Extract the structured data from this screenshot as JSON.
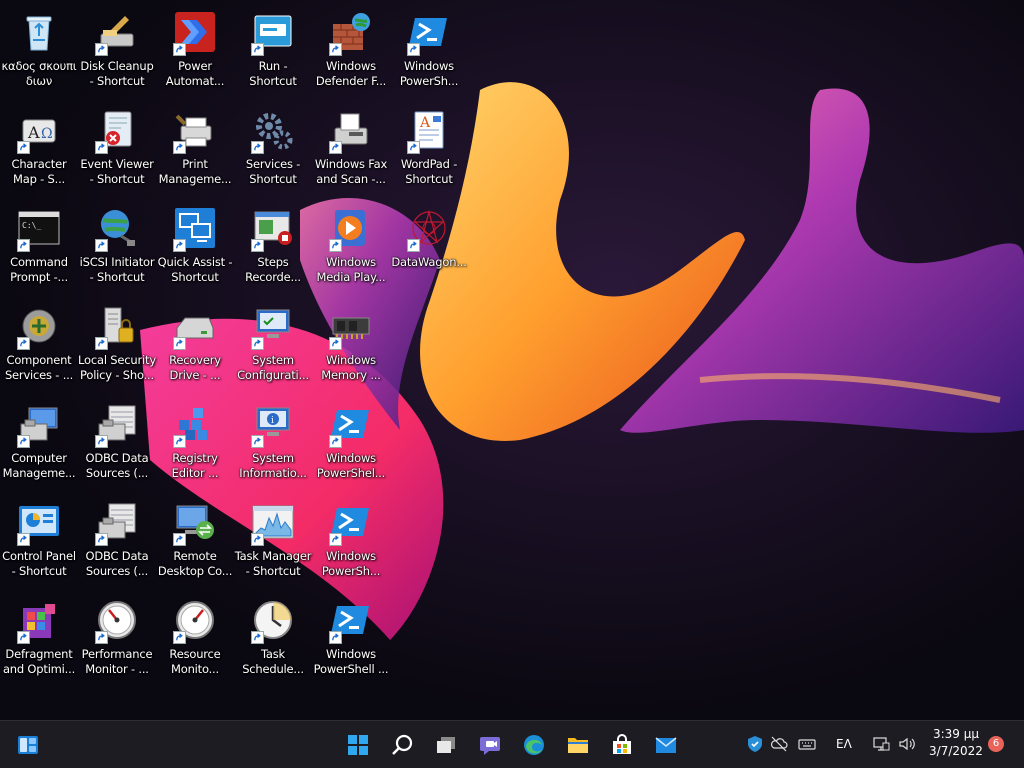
{
  "desktop_icons": [
    {
      "label": "καδος σκουπι\nδιων",
      "icon": "recycle-bin-icon",
      "shortcut": false
    },
    {
      "label": "Disk Cleanup\n- Shortcut",
      "icon": "disk-cleanup-icon",
      "shortcut": true
    },
    {
      "label": "Power\nAutomat...",
      "icon": "power-automate-icon",
      "shortcut": true
    },
    {
      "label": "Run -\nShortcut",
      "icon": "run-icon",
      "shortcut": true
    },
    {
      "label": "Windows\nDefender F...",
      "icon": "firewall-icon",
      "shortcut": true
    },
    {
      "label": "Windows\nPowerSh...",
      "icon": "powershell-icon",
      "shortcut": true
    },
    {
      "label": "Character\nMap - S...",
      "icon": "character-map-icon",
      "shortcut": true
    },
    {
      "label": "Event Viewer\n- Shortcut",
      "icon": "event-viewer-icon",
      "shortcut": true
    },
    {
      "label": "Print\nManageme...",
      "icon": "print-management-icon",
      "shortcut": true
    },
    {
      "label": "Services -\nShortcut",
      "icon": "services-icon",
      "shortcut": true
    },
    {
      "label": "Windows Fax\nand Scan -...",
      "icon": "fax-icon",
      "shortcut": true
    },
    {
      "label": "WordPad -\nShortcut",
      "icon": "wordpad-icon",
      "shortcut": true
    },
    {
      "label": "Command\nPrompt -...",
      "icon": "command-prompt-icon",
      "shortcut": true
    },
    {
      "label": "iSCSI Initiator\n- Shortcut",
      "icon": "iscsi-icon",
      "shortcut": true
    },
    {
      "label": "Quick Assist -\nShortcut",
      "icon": "quick-assist-icon",
      "shortcut": true
    },
    {
      "label": "Steps\nRecorde...",
      "icon": "steps-recorder-icon",
      "shortcut": true
    },
    {
      "label": "Windows\nMedia Play...",
      "icon": "media-player-icon",
      "shortcut": true
    },
    {
      "label": "DataWagon...",
      "icon": "datawagon-icon",
      "shortcut": true
    },
    {
      "label": "Component\nServices - ...",
      "icon": "component-services-icon",
      "shortcut": true
    },
    {
      "label": "Local Security\nPolicy - Sho...",
      "icon": "local-security-icon",
      "shortcut": true
    },
    {
      "label": "Recovery\nDrive - ...",
      "icon": "recovery-drive-icon",
      "shortcut": true
    },
    {
      "label": "System\nConfigurati...",
      "icon": "system-config-icon",
      "shortcut": true
    },
    {
      "label": "Windows\nMemory ...",
      "icon": "memory-diagnostic-icon",
      "shortcut": true
    },
    {
      "label": "Computer\nManageme...",
      "icon": "computer-management-icon",
      "shortcut": true
    },
    {
      "label": "ODBC Data\nSources (...",
      "icon": "odbc-icon",
      "shortcut": true
    },
    {
      "label": "Registry\nEditor ...",
      "icon": "registry-editor-icon",
      "shortcut": true
    },
    {
      "label": "System\nInformatio...",
      "icon": "system-info-icon",
      "shortcut": true
    },
    {
      "label": "Windows\nPowerShel...",
      "icon": "powershell-icon",
      "shortcut": true
    },
    {
      "label": "Control Panel\n- Shortcut",
      "icon": "control-panel-icon",
      "shortcut": true
    },
    {
      "label": "ODBC Data\nSources (...",
      "icon": "odbc-icon",
      "shortcut": true
    },
    {
      "label": "Remote\nDesktop Co...",
      "icon": "remote-desktop-icon",
      "shortcut": true
    },
    {
      "label": "Task Manager\n- Shortcut",
      "icon": "task-manager-icon",
      "shortcut": true
    },
    {
      "label": "Windows\nPowerSh...",
      "icon": "powershell-icon",
      "shortcut": true
    },
    {
      "label": "Defragment\nand Optimi...",
      "icon": "defragment-icon",
      "shortcut": true
    },
    {
      "label": "Performance\nMonitor - ...",
      "icon": "performance-monitor-icon",
      "shortcut": true
    },
    {
      "label": "Resource\nMonito...",
      "icon": "resource-monitor-icon",
      "shortcut": true
    },
    {
      "label": "Task\nSchedule...",
      "icon": "task-scheduler-icon",
      "shortcut": true
    },
    {
      "label": "Windows\nPowerShell ...",
      "icon": "powershell-icon",
      "shortcut": true
    }
  ],
  "taskbar": {
    "apps": [
      {
        "name": "start-button",
        "icon": "windows-start-icon"
      },
      {
        "name": "search-button",
        "icon": "search-icon"
      },
      {
        "name": "task-view-button",
        "icon": "task-view-icon"
      },
      {
        "name": "chat-button",
        "icon": "teams-chat-icon"
      },
      {
        "name": "edge-button",
        "icon": "edge-icon"
      },
      {
        "name": "file-explorer-button",
        "icon": "folder-icon"
      },
      {
        "name": "store-button",
        "icon": "store-icon"
      },
      {
        "name": "mail-button",
        "icon": "mail-icon"
      }
    ],
    "tray_icons": [
      "defender-tray-icon",
      "onedrive-tray-icon",
      "keyboard-tray-icon",
      "network-tray-icon",
      "volume-tray-icon"
    ],
    "language": "ΕΛ",
    "clock_time": "3:39 μμ",
    "clock_date": "3/7/2022",
    "notification_count": "6"
  },
  "colors": {
    "taskbar_bg": "#1c1c22",
    "accent": "#0078d4"
  }
}
